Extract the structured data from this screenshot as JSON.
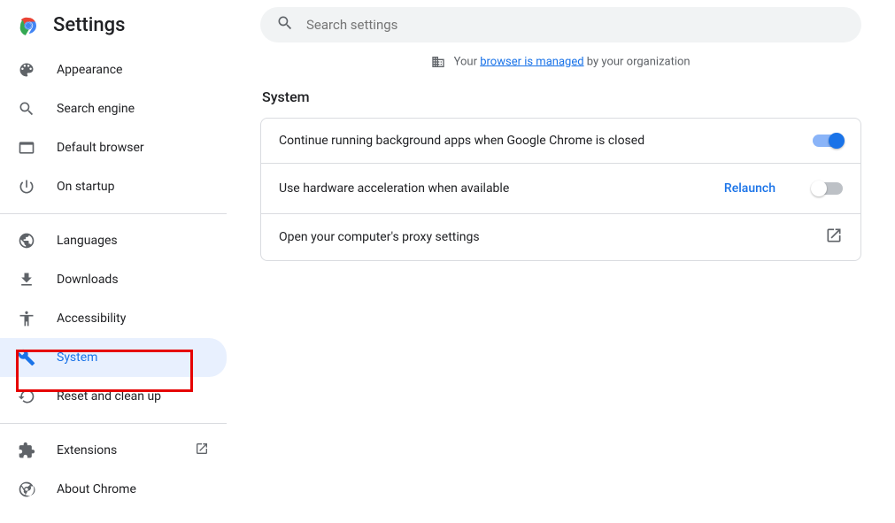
{
  "header": {
    "title": "Settings"
  },
  "search": {
    "placeholder": "Search settings"
  },
  "managed_notice": {
    "prefix": "Your ",
    "link": "browser is managed",
    "suffix": " by your organization"
  },
  "sidebar": {
    "items": [
      {
        "label": "Appearance"
      },
      {
        "label": "Search engine"
      },
      {
        "label": "Default browser"
      },
      {
        "label": "On startup"
      },
      {
        "label": "Languages"
      },
      {
        "label": "Downloads"
      },
      {
        "label": "Accessibility"
      },
      {
        "label": "System"
      },
      {
        "label": "Reset and clean up"
      },
      {
        "label": "Extensions"
      },
      {
        "label": "About Chrome"
      }
    ]
  },
  "system": {
    "title": "System",
    "rows": [
      {
        "label": "Continue running background apps when Google Chrome is closed",
        "toggle_on": true
      },
      {
        "label": "Use hardware acceleration when available",
        "relaunch": "Relaunch",
        "toggle_on": false
      },
      {
        "label": "Open your computer's proxy settings"
      }
    ]
  }
}
